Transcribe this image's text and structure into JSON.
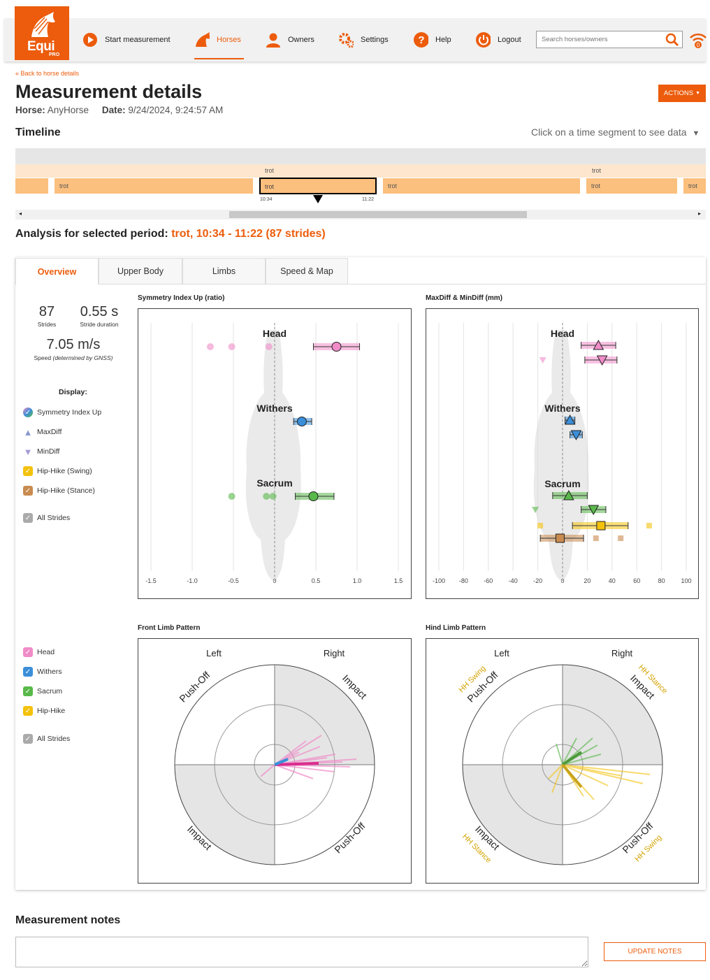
{
  "header": {
    "brand": "Equi",
    "brand_sub": "PRO",
    "nav": [
      {
        "label": "Start measurement",
        "icon": "play-icon"
      },
      {
        "label": "Horses",
        "icon": "horse-icon",
        "active": true
      },
      {
        "label": "Owners",
        "icon": "person-icon"
      },
      {
        "label": "Settings",
        "icon": "gears-icon"
      },
      {
        "label": "Help",
        "icon": "help-icon"
      },
      {
        "label": "Logout",
        "icon": "power-icon"
      }
    ],
    "search_placeholder": "Search horses/owners",
    "signal_badge": "0",
    "accent": "#ec5c0c"
  },
  "page": {
    "back_link": "« Back to horse details",
    "title": "Measurement details",
    "actions_label": "ACTIONS",
    "horse_label": "Horse:",
    "horse_value": "AnyHorse",
    "date_label": "Date:",
    "date_value": "9/24/2024, 9:24:57 AM"
  },
  "timeline": {
    "title": "Timeline",
    "hint": "Click on a time segment to see data",
    "upper_segments": [
      "trot",
      "trot"
    ],
    "segments": [
      "trot",
      "trot",
      "trot",
      "trot",
      "trot"
    ],
    "selected_start": "10:34",
    "selected_end": "11:22"
  },
  "analysis": {
    "prefix": "Analysis for selected period:",
    "period": "trot, 10:34 - 11:22 (87 strides)"
  },
  "tabs": [
    "Overview",
    "Upper Body",
    "Limbs",
    "Speed & Map"
  ],
  "stats": {
    "strides_value": "87",
    "strides_label": "Strides",
    "duration_value": "0.55 s",
    "duration_label": "Stride duration",
    "speed_value": "7.05 m/s",
    "speed_label": "Speed",
    "speed_note": "(determined by GNSS)"
  },
  "display": {
    "title": "Display:",
    "items": [
      {
        "label": "Symmetry Index Up",
        "color": "#7c9bd6"
      },
      {
        "label": "MaxDiff",
        "color": "#9aa3c9"
      },
      {
        "label": "MinDiff",
        "color": "#b6a6d8"
      },
      {
        "label": "Hip-Hike (Swing)",
        "color": "#f4c20d"
      },
      {
        "label": "Hip-Hike (Stance)",
        "color": "#c98b4f"
      },
      {
        "label": "All Strides",
        "color": "#aaaaaa"
      }
    ]
  },
  "limb_display": {
    "items": [
      {
        "label": "Head",
        "color": "#f08cc8"
      },
      {
        "label": "Withers",
        "color": "#3b8fd9"
      },
      {
        "label": "Sacrum",
        "color": "#59b84a"
      },
      {
        "label": "Hip-Hike",
        "color": "#f4c20d"
      },
      {
        "label": "All Strides",
        "color": "#aaaaaa"
      }
    ]
  },
  "panels": {
    "symmetry_title": "Symmetry Index Up (ratio)",
    "maxmin_title": "MaxDiff & MinDiff (mm)",
    "front_title": "Front Limb Pattern",
    "hind_title": "Hind Limb Pattern",
    "body_labels": [
      "Head",
      "Withers",
      "Sacrum"
    ],
    "sym_ticks": [
      "-1.5",
      "-1.0",
      "-0.5",
      "0",
      "0.5",
      "1.0",
      "1.5"
    ],
    "mm_ticks": [
      "-100",
      "-80",
      "-60",
      "-40",
      "-20",
      "0",
      "20",
      "40",
      "60",
      "80",
      "100"
    ],
    "left": "Left",
    "right": "Right",
    "push_off": "Push-Off",
    "impact": "Impact",
    "hh_swing": "HH Swing",
    "hh_stance": "HH Stance"
  },
  "chart_data": [
    {
      "type": "scatter",
      "title": "Symmetry Index Up (ratio)",
      "xlim": [
        -1.5,
        1.5
      ],
      "series": [
        {
          "name": "Head",
          "color": "#f08cc8",
          "mean": 0.75,
          "ci": [
            0.47,
            1.03
          ]
        },
        {
          "name": "Withers",
          "color": "#3b8fd9",
          "mean": 0.33,
          "ci": [
            0.23,
            0.45
          ]
        },
        {
          "name": "Sacrum",
          "color": "#59b84a",
          "mean": 0.47,
          "ci": [
            0.25,
            0.72
          ]
        }
      ]
    },
    {
      "type": "scatter",
      "title": "MaxDiff & MinDiff (mm)",
      "xlim": [
        -100,
        100
      ],
      "series": [
        {
          "name": "Head MaxDiff",
          "mean": 29,
          "ci": [
            15,
            43
          ]
        },
        {
          "name": "Head MinDiff",
          "mean": 32,
          "ci": [
            18,
            44
          ]
        },
        {
          "name": "Withers MaxDiff",
          "mean": 6,
          "ci": [
            2,
            10
          ]
        },
        {
          "name": "Withers MinDiff",
          "mean": 11,
          "ci": [
            6,
            16
          ]
        },
        {
          "name": "Sacrum MaxDiff",
          "mean": 5,
          "ci": [
            -8,
            20
          ]
        },
        {
          "name": "Sacrum MinDiff",
          "mean": 25,
          "ci": [
            15,
            35
          ]
        },
        {
          "name": "Hip-Hike (Swing)",
          "mean": 31,
          "ci": [
            8,
            53
          ]
        },
        {
          "name": "Hip-Hike (Stance)",
          "mean": -2,
          "ci": [
            -18,
            17
          ]
        }
      ]
    }
  ]
}
